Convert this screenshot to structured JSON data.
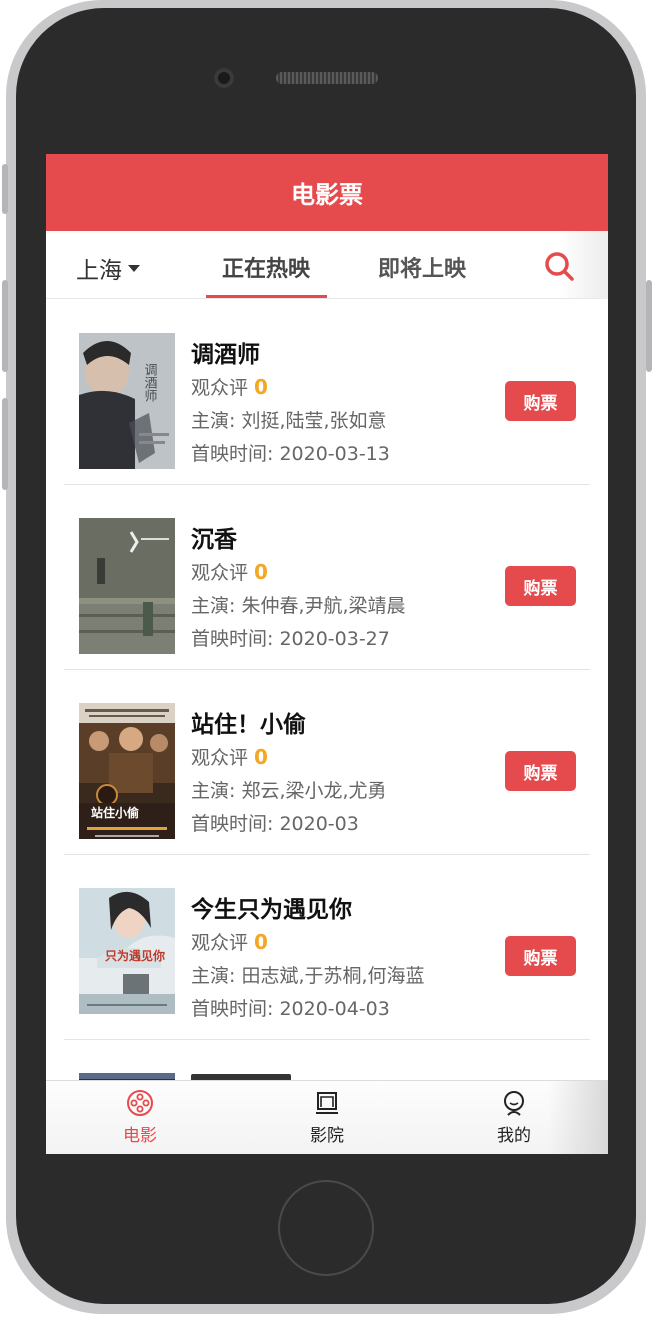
{
  "app": {
    "title": "电影票"
  },
  "subnav": {
    "city": "上海",
    "tabs": [
      "正在热映",
      "即将上映"
    ],
    "active_tab": "正在热映"
  },
  "movies": [
    {
      "title": "调酒师",
      "rating_label": "观众评",
      "score": "0",
      "cast": "主演: 刘挺,陆莹,张如意",
      "release": "首映时间: 2020-03-13",
      "buy_label": "购票"
    },
    {
      "title": "沉香",
      "rating_label": "观众评",
      "score": "0",
      "cast": "主演: 朱仲春,尹航,梁靖晨",
      "release": "首映时间: 2020-03-27",
      "buy_label": "购票"
    },
    {
      "title": "站住！小偷",
      "rating_label": "观众评",
      "score": "0",
      "cast": "主演: 郑云,梁小龙,尤勇",
      "release": "首映时间: 2020-03",
      "buy_label": "购票"
    },
    {
      "title": "今生只为遇见你",
      "rating_label": "观众评",
      "score": "0",
      "cast": "主演: 田志斌,于苏桐,何海蓝",
      "release": "首映时间: 2020-04-03",
      "buy_label": "购票"
    }
  ],
  "poster_text": {
    "p1_title": "调酒师",
    "p3_title": "站住小偷",
    "p4_title": "只为遇见你"
  },
  "tabbar": {
    "items": [
      {
        "label": "电影",
        "icon": "film-reel-icon"
      },
      {
        "label": "影院",
        "icon": "cinema-screen-icon"
      },
      {
        "label": "我的",
        "icon": "user-icon"
      }
    ]
  },
  "colors": {
    "brand": "#e54a4d",
    "score": "#f5a623"
  }
}
